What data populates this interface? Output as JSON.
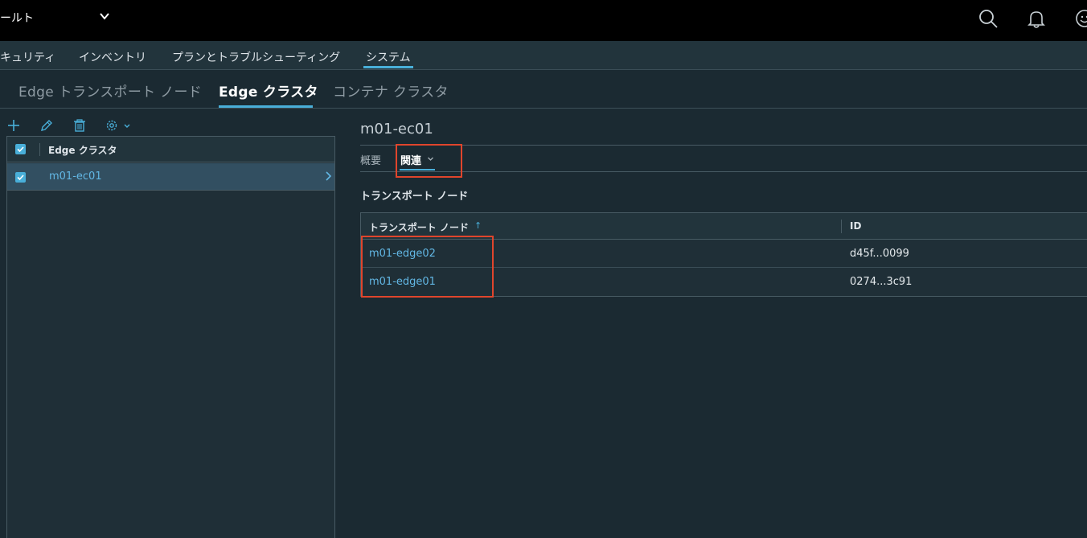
{
  "header": {
    "title": "ールト",
    "icons": [
      "search-icon",
      "bell-icon",
      "user-icon"
    ]
  },
  "main_nav": {
    "items": [
      {
        "label": "キュリティ"
      },
      {
        "label": "インベントリ"
      },
      {
        "label": "プランとトラブルシューティング"
      },
      {
        "label": "システム",
        "active": true
      }
    ]
  },
  "sub_tabs": {
    "items": [
      {
        "label": "Edge トランスポート ノード"
      },
      {
        "label": "Edge クラスタ",
        "active": true
      },
      {
        "label": "コンテナ クラスタ"
      }
    ]
  },
  "left_toolbar": {
    "icons": [
      "add-icon",
      "edit-icon",
      "delete-icon",
      "settings-icon"
    ]
  },
  "left_grid": {
    "column_header": "Edge クラスタ",
    "rows": [
      {
        "name": "m01-ec01",
        "selected": true
      }
    ]
  },
  "detail": {
    "title": "m01-ec01",
    "tabs": [
      {
        "label": "概要"
      },
      {
        "label": "関連",
        "active": true
      }
    ],
    "section_title": "トランスポート ノード",
    "table": {
      "columns": [
        "トランスポート ノード",
        "ID"
      ],
      "sort_indicator": "↑",
      "rows": [
        {
          "node": "m01-edge02",
          "id": "d45f...0099"
        },
        {
          "node": "m01-edge01",
          "id": "0274...3c91"
        }
      ]
    }
  },
  "colors": {
    "accent": "#49afd9",
    "link": "#62b7e4",
    "highlight": "#e0452c",
    "background": "#1b2a32"
  }
}
